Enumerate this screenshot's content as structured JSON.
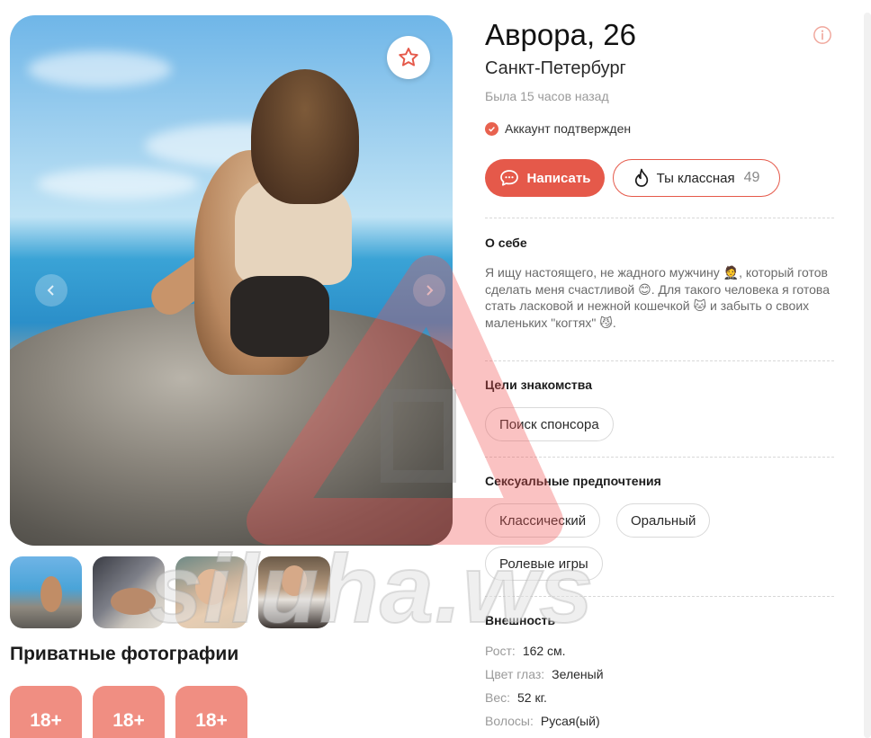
{
  "profile": {
    "name_age": "Аврора, 26",
    "city": "Санкт-Петербург",
    "last_seen": "Была 15 часов назад",
    "verified": "Аккаунт подтвержден"
  },
  "actions": {
    "message_label": "Написать",
    "like_label": "Ты классная",
    "like_count": "49"
  },
  "about": {
    "title": "О себе",
    "text_1": "Я ищу настоящего, не жадного мужчину ",
    "emoji_1": "🤵",
    "text_2": ", который готов сделать меня счастливой ",
    "emoji_2": "😊",
    "text_3": ". Для такого человека я готова стать ласковой и нежной кошечкой ",
    "emoji_3": "🐱",
    "text_4": " и забыть о своих маленьких \"когтях\" ",
    "emoji_4": "😼",
    "text_5": "."
  },
  "goals": {
    "title": "Цели знакомства",
    "items": [
      "Поиск спонсора"
    ]
  },
  "preferences": {
    "title": "Сексуальные предпочтения",
    "items": [
      "Классический",
      "Оральный",
      "Ролевые игры"
    ]
  },
  "appearance": {
    "title": "Внешность",
    "rows": [
      {
        "label": "Рост:",
        "value": "162 см."
      },
      {
        "label": "Цвет глаз:",
        "value": "Зеленый"
      },
      {
        "label": "Вес:",
        "value": "52 кг."
      },
      {
        "label": "Волосы:",
        "value": "Русая(ый)"
      }
    ]
  },
  "private_photos": {
    "title": "Приватные фотографии",
    "tiles": [
      "18+",
      "18+",
      "18+"
    ]
  },
  "watermark": "siluha.ws",
  "colors": {
    "accent": "#e5594a",
    "private_tile": "#f08e82"
  },
  "icons": {
    "favorite": "star-outline-icon",
    "info": "info-circle-icon",
    "message": "chat-bubble-icon",
    "like": "flame-icon",
    "verified": "check-circle-icon"
  }
}
